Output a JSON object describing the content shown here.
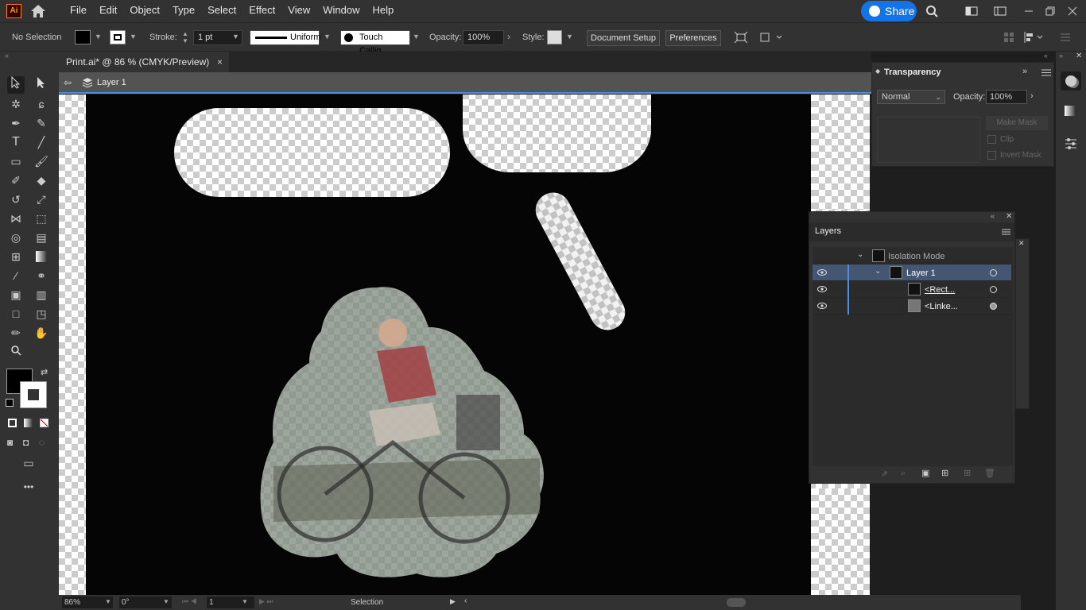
{
  "app": {
    "logo": "Ai"
  },
  "menu": [
    "File",
    "Edit",
    "Object",
    "Type",
    "Select",
    "Effect",
    "View",
    "Window",
    "Help"
  ],
  "share": {
    "label": "Share"
  },
  "control": {
    "selection": "No Selection",
    "stroke_label": "Stroke:",
    "stroke_weight": "1 pt",
    "stroke_profile": "Uniform",
    "brush": "Touch Callig...",
    "opacity_label": "Opacity:",
    "opacity_value": "100%",
    "style_label": "Style:",
    "document_setup": "Document Setup",
    "preferences": "Preferences"
  },
  "tab": {
    "title": "Print.ai* @ 86 % (CMYK/Preview)",
    "close": "×"
  },
  "isolation": {
    "layer": "Layer 1"
  },
  "transparency": {
    "title": "Transparency",
    "blend_mode": "Normal",
    "opacity_label": "Opacity:",
    "opacity_value": "100%",
    "make_mask": "Make Mask",
    "clip": "Clip",
    "invert_mask": "Invert Mask"
  },
  "layers": {
    "title": "Layers",
    "rows": [
      {
        "label": "Isolation Mode"
      },
      {
        "label": "Layer 1"
      },
      {
        "label": "<Rect..."
      },
      {
        "label": "<Linke..."
      }
    ]
  },
  "status": {
    "zoom": "86%",
    "rotation": "0°",
    "artboard": "1",
    "tool": "Selection"
  },
  "colors": {
    "accent": "#1473e6",
    "selection_blue": "#4a8fe7",
    "canvas_black": "#050505"
  },
  "icons": [
    "home-icon",
    "search-icon",
    "arrange-icon",
    "workspace-icon",
    "minimize-icon",
    "restore-icon",
    "close-icon",
    "eye-icon"
  ]
}
